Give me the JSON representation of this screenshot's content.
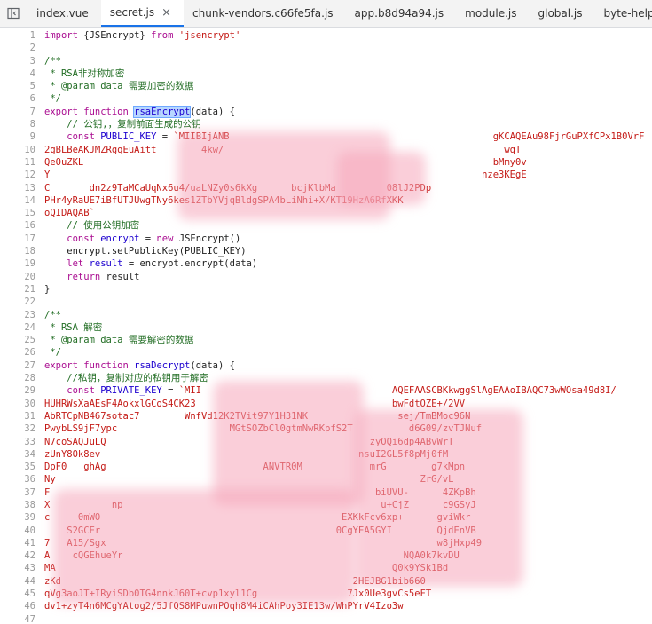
{
  "tabs": [
    {
      "label": "index.vue",
      "active": false
    },
    {
      "label": "secret.js",
      "active": true,
      "close": "×"
    },
    {
      "label": "chunk-vendors.c66fe5fa.js",
      "active": false
    },
    {
      "label": "app.b8d94a94.js",
      "active": false
    },
    {
      "label": "module.js",
      "active": false
    },
    {
      "label": "global.js",
      "active": false
    },
    {
      "label": "byte-helpers.js",
      "active": false
    }
  ],
  "code": {
    "l1": {
      "n": "1",
      "a": "import ",
      "b": "{JSEncrypt}",
      "c": " from ",
      "d": "'jsencrypt'"
    },
    "l2": {
      "n": "2"
    },
    "l3": {
      "n": "3",
      "t": "/**"
    },
    "l4": {
      "n": "4",
      "t": " * RSA非对称加密"
    },
    "l5": {
      "n": "5",
      "t": " * @param data 需要加密的数据"
    },
    "l6": {
      "n": "6",
      "t": " */"
    },
    "l7": {
      "n": "7",
      "a": "export function ",
      "b": "rsaEncrypt",
      "c": "(data) {"
    },
    "l8": {
      "n": "8",
      "t": "    // 公钥,，复制前面生成的公钥"
    },
    "l9": {
      "n": "9",
      "a": "    const ",
      "b": "PUBLIC_KEY",
      "c": " = ",
      "d": "`MIIBIjANB                                               gKCAQEAu98FjrGuPXfCPx1B0VrF"
    },
    "l10": {
      "n": "10",
      "t": "2gBLBeAKJMZRgqEuAitt        4kw/                                                  wqT"
    },
    "l11": {
      "n": "11",
      "t": "QeOuZKL                                                                         bMmy0v"
    },
    "l12": {
      "n": "12",
      "t": "Y                                                                             nze3KEgE"
    },
    "l13": {
      "n": "13",
      "t": "C       dn2z9TaMCaUqNx6u4/uaLNZy0s6kXg      bcjKlbMa         08lJ2PDp"
    },
    "l14": {
      "n": "14",
      "t": "PHr4yRaUE7iBfUTJUwgTNy6kes1ZTbYVjqBldgSPA4bLiNhi+X/KT19HzA6RfXKK"
    },
    "l15": {
      "n": "15",
      "t": "oQIDAQAB`"
    },
    "l16": {
      "n": "16",
      "t": "    // 使用公钥加密"
    },
    "l17": {
      "n": "17",
      "a": "    const ",
      "b": "encrypt",
      "c": " = ",
      "d": "new ",
      "e": "JSEncrypt()"
    },
    "l18": {
      "n": "18",
      "t": "    encrypt.setPublicKey(PUBLIC_KEY)"
    },
    "l19": {
      "n": "19",
      "a": "    let ",
      "b": "result",
      "c": " = encrypt.encrypt(data)"
    },
    "l20": {
      "n": "20",
      "a": "    return ",
      "b": "result"
    },
    "l21": {
      "n": "21",
      "t": "}"
    },
    "l22": {
      "n": "22"
    },
    "l23": {
      "n": "23",
      "t": "/**"
    },
    "l24": {
      "n": "24",
      "t": " * RSA 解密"
    },
    "l25": {
      "n": "25",
      "t": " * @param data 需要解密的数据"
    },
    "l26": {
      "n": "26",
      "t": " */"
    },
    "l27": {
      "n": "27",
      "a": "export function ",
      "b": "rsaDecrypt",
      "c": "(data) {"
    },
    "l28": {
      "n": "28",
      "t": "    //私钥，复制对应的私钥用于解密"
    },
    "l29": {
      "n": "29",
      "a": "    const ",
      "b": "PRIVATE_KEY",
      "c": " = ",
      "d": "`MII                                  AQEFAASCBKkwggSlAgEAAoIBAQC73wWOsa49d8I/"
    },
    "l30": {
      "n": "30",
      "t": "HUHRWsXaAEsF4AokxlGCoS4CK23                                   bwFdtOZE+/2VV"
    },
    "l31": {
      "n": "31",
      "t": "AbRTCpNB467sotac7        WnfVd12K2TVit97Y1H31NK                sej/TmBMoc96N"
    },
    "l32": {
      "n": "32",
      "t": "PwybLS9jF7ypc                    MGtSOZbCl0gtmNwRKpfS2T          d6G09/zvTJNuf"
    },
    "l33": {
      "n": "33",
      "t": "N7coSAQJuLQ                                               zyOQi6dp4ABvWrT"
    },
    "l34": {
      "n": "34",
      "t": "zUnY8Ok8ev                                              nsuI2GL5f8pMj0fM"
    },
    "l35": {
      "n": "35",
      "t": "DpF0   ghAg                            ANVTR0M            mrG        g7kMpn"
    },
    "l36": {
      "n": "36",
      "t": "Ny                                                                 ZrG/vL"
    },
    "l37": {
      "n": "37",
      "t": "F                                                          biUVU-      4ZKpBh"
    },
    "l38": {
      "n": "38",
      "t": "X           np                                              u+CjZ      c9GSyJ"
    },
    "l39": {
      "n": "39",
      "t": "c     0mWO                                           EXKkFcv6xp+      gviWkr"
    },
    "l40": {
      "n": "40",
      "t": "    S2GCEr                                          0CgYEA5GYI        QjdEnVB"
    },
    "l41": {
      "n": "41",
      "t": "7   A15/Sgx                                                           w8jHxp49"
    },
    "l42": {
      "n": "42",
      "t": "A    cQGEhueYr                                                  NQA0k7kvDU"
    },
    "l43": {
      "n": "43",
      "t": "MA                                                            Q0k9YSk1Bd"
    },
    "l44": {
      "n": "44",
      "t": "zKd                                                    2HEJBG1bib660"
    },
    "l45": {
      "n": "45",
      "t": "qVg3aoJT+IRyiSDb0TG4nnkJ60T+cvp1xyl1Cg                7Jx0Ue3gvCs5eFT"
    },
    "l46": {
      "n": "46",
      "t": "dv1+zyT4n6MCgYAtog2/5JfQS8MPuwnPOqh8M4iCAhPoy3IE13w/WhPYrV4Izo3w"
    },
    "l47": {
      "n": "47",
      "t": "                                                                "
    }
  }
}
